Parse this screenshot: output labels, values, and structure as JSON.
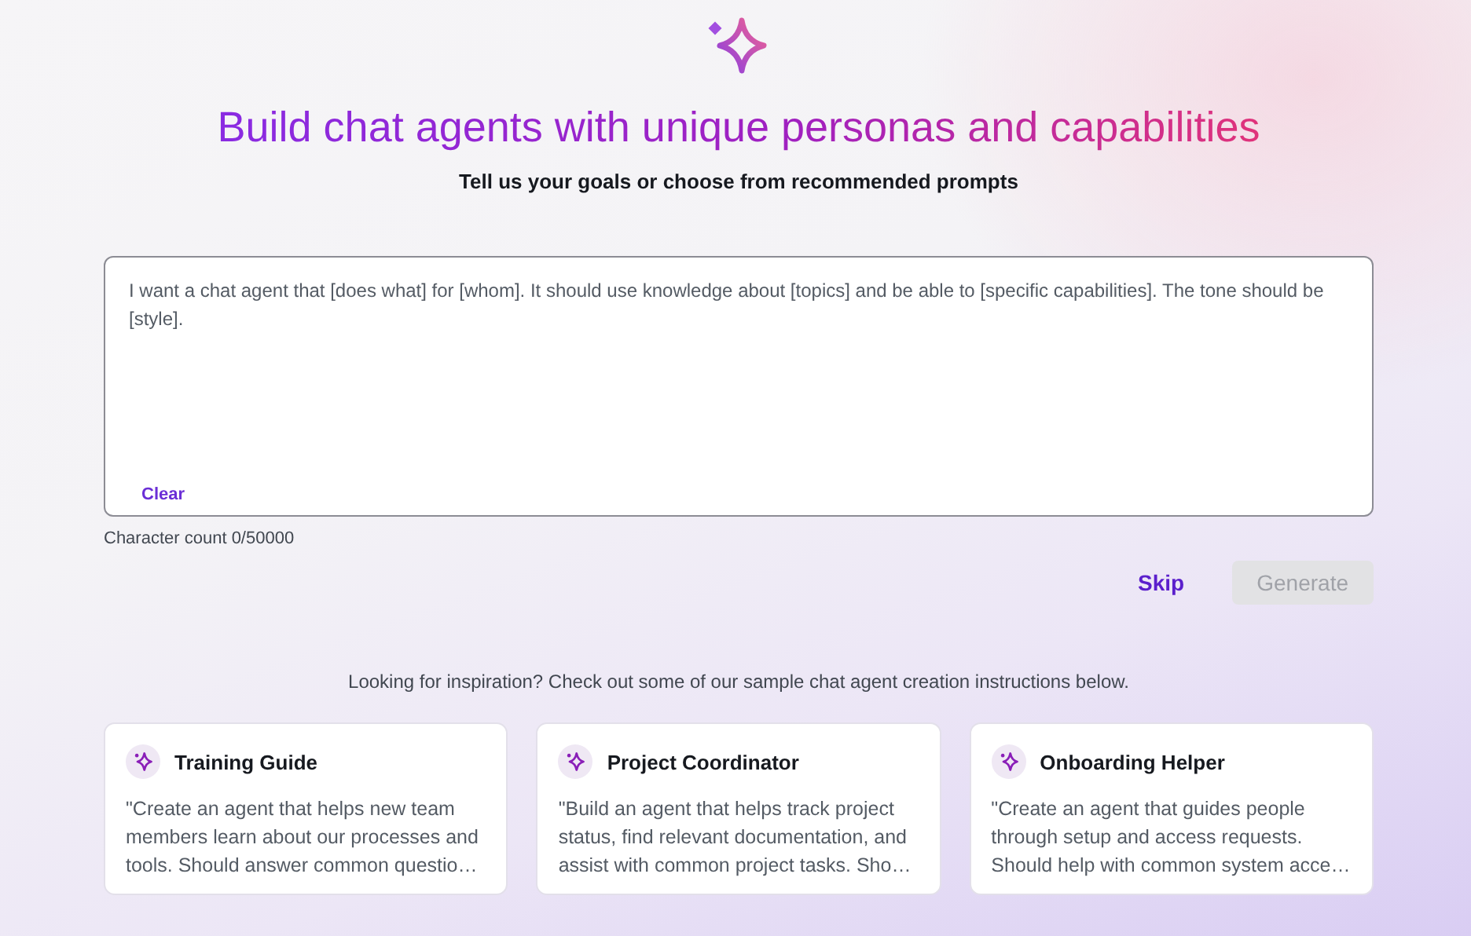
{
  "header": {
    "title": "Build chat agents with unique personas and capabilities",
    "subtitle": "Tell us your goals or choose from recommended prompts"
  },
  "prompt": {
    "placeholder": "I want a chat agent that [does what] for [whom]. It should use knowledge about [topics] and be able to [specific capabilities]. The tone should be [style].",
    "clear_label": "Clear",
    "character_count": "Character count 0/50000"
  },
  "actions": [
    {
      "label": "Skip",
      "kind": "link",
      "disabled": false
    },
    {
      "label": "Generate",
      "kind": "primary",
      "disabled": true
    }
  ],
  "inspiration": "Looking for inspiration? Check out some of our sample chat agent creation instructions below.",
  "samples": [
    {
      "title": "Training Guide",
      "text": "\"Create an agent that helps new team members learn about our processes and tools. Should answer common questio…"
    },
    {
      "title": "Project Coordinator",
      "text": "\"Build an agent that helps track project status, find relevant documentation, and assist with common project tasks. Sho…"
    },
    {
      "title": "Onboarding Helper",
      "text": "\"Create an agent that guides people through setup and access requests. Should help with common system acce…"
    }
  ]
}
